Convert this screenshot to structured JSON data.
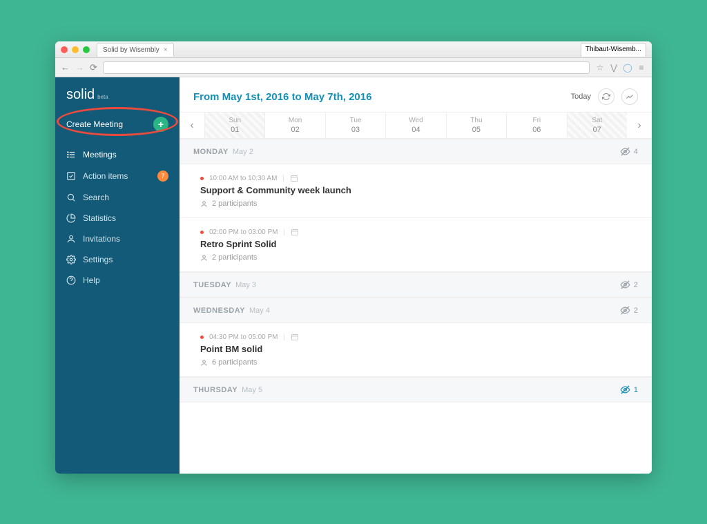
{
  "browser": {
    "tab_title": "Solid by Wisembly",
    "user_tab": "Thibaut-Wisemb..."
  },
  "sidebar": {
    "brand": "solid",
    "brand_tag": "beta",
    "create_label": "Create Meeting",
    "items": [
      {
        "label": "Meetings",
        "active": true,
        "icon": "list"
      },
      {
        "label": "Action items",
        "icon": "check",
        "badge": "7"
      },
      {
        "label": "Search",
        "icon": "search"
      },
      {
        "label": "Statistics",
        "icon": "pie"
      },
      {
        "label": "Invitations",
        "icon": "user"
      },
      {
        "label": "Settings",
        "icon": "gear"
      },
      {
        "label": "Help",
        "icon": "help"
      }
    ]
  },
  "header": {
    "title": "From May 1st, 2016 to May 7th, 2016",
    "today": "Today"
  },
  "daystrip": [
    {
      "name": "Sun",
      "num": "01",
      "weekend": true
    },
    {
      "name": "Mon",
      "num": "02"
    },
    {
      "name": "Tue",
      "num": "03"
    },
    {
      "name": "Wed",
      "num": "04"
    },
    {
      "name": "Thu",
      "num": "05"
    },
    {
      "name": "Fri",
      "num": "06"
    },
    {
      "name": "Sat",
      "num": "07",
      "weekend": true
    }
  ],
  "days": [
    {
      "dow": "MONDAY",
      "date": "May 2",
      "count": "4",
      "alt": false,
      "meetings": [
        {
          "time": "10:00 AM to 10:30 AM",
          "title": "Support & Community week launch",
          "participants": "2 participants"
        },
        {
          "time": "02:00 PM to 03:00 PM",
          "title": "Retro Sprint Solid",
          "participants": "2 participants"
        }
      ]
    },
    {
      "dow": "TUESDAY",
      "date": "May 3",
      "count": "2",
      "alt": false,
      "meetings": []
    },
    {
      "dow": "WEDNESDAY",
      "date": "May 4",
      "count": "2",
      "alt": false,
      "meetings": [
        {
          "time": "04:30 PM to 05:00 PM",
          "title": "Point BM solid",
          "participants": "6 participants"
        }
      ]
    },
    {
      "dow": "THURSDAY",
      "date": "May 5",
      "count": "1",
      "alt": true,
      "meetings": []
    }
  ]
}
